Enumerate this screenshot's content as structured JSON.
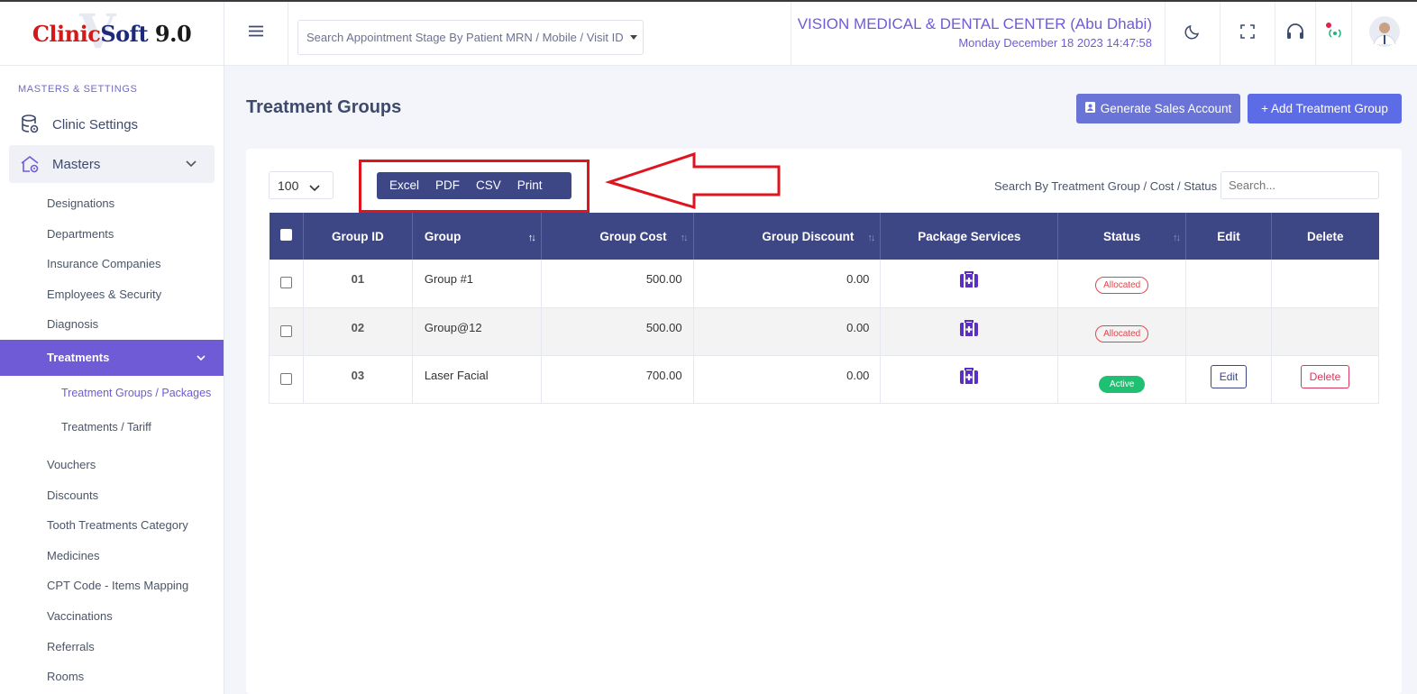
{
  "brand": {
    "mark": "V",
    "clinic": "Clinic",
    "soft": "Soft",
    "version": " 9.0"
  },
  "sidebar": {
    "section_title": "MASTERS & SETTINGS",
    "clinic_settings": "Clinic Settings",
    "masters": "Masters",
    "items": [
      "Designations",
      "Departments",
      "Insurance Companies",
      "Employees & Security",
      "Diagnosis"
    ],
    "treatments": "Treatments",
    "treatment_sub": [
      "Treatment Groups / Packages",
      "Treatments / Tariff"
    ],
    "items_after": [
      "Vouchers",
      "Discounts",
      "Tooth Treatments Category",
      "Medicines",
      "CPT Code - Items Mapping",
      "Vaccinations",
      "Referrals",
      "Rooms"
    ]
  },
  "header": {
    "search_placeholder": "Search Appointment Stage By Patient MRN / Mobile / Visit ID",
    "clinic_name": "VISION MEDICAL & DENTAL CENTER (Abu Dhabi)",
    "datetime": "Monday December 18 2023 14:47:58"
  },
  "page": {
    "title": "Treatment Groups",
    "generate_btn": "Generate Sales Account",
    "add_btn": "+ Add Treatment Group",
    "page_length": "100",
    "export_buttons": [
      "Excel",
      "PDF",
      "CSV",
      "Print"
    ],
    "search_label": "Search By Treatment Group / Cost / Status",
    "search_placeholder": "Search..."
  },
  "table": {
    "headers": [
      "Group ID",
      "Group",
      "Group Cost",
      "Group Discount",
      "Package Services",
      "Status",
      "Edit",
      "Delete"
    ],
    "rows": [
      {
        "id": "01",
        "group": "Group #1",
        "cost": "500.00",
        "discount": "0.00",
        "status": "Allocated"
      },
      {
        "id": "02",
        "group": "Group@12",
        "cost": "500.00",
        "discount": "0.00",
        "status": "Allocated"
      },
      {
        "id": "03",
        "group": "Laser Facial",
        "cost": "700.00",
        "discount": "0.00",
        "status": "Active",
        "edit": "Edit",
        "delete": "Delete"
      }
    ]
  },
  "colors": {
    "accent": "#6f5bd6",
    "table_header": "#3e4786",
    "highlight": "#e0141e"
  }
}
